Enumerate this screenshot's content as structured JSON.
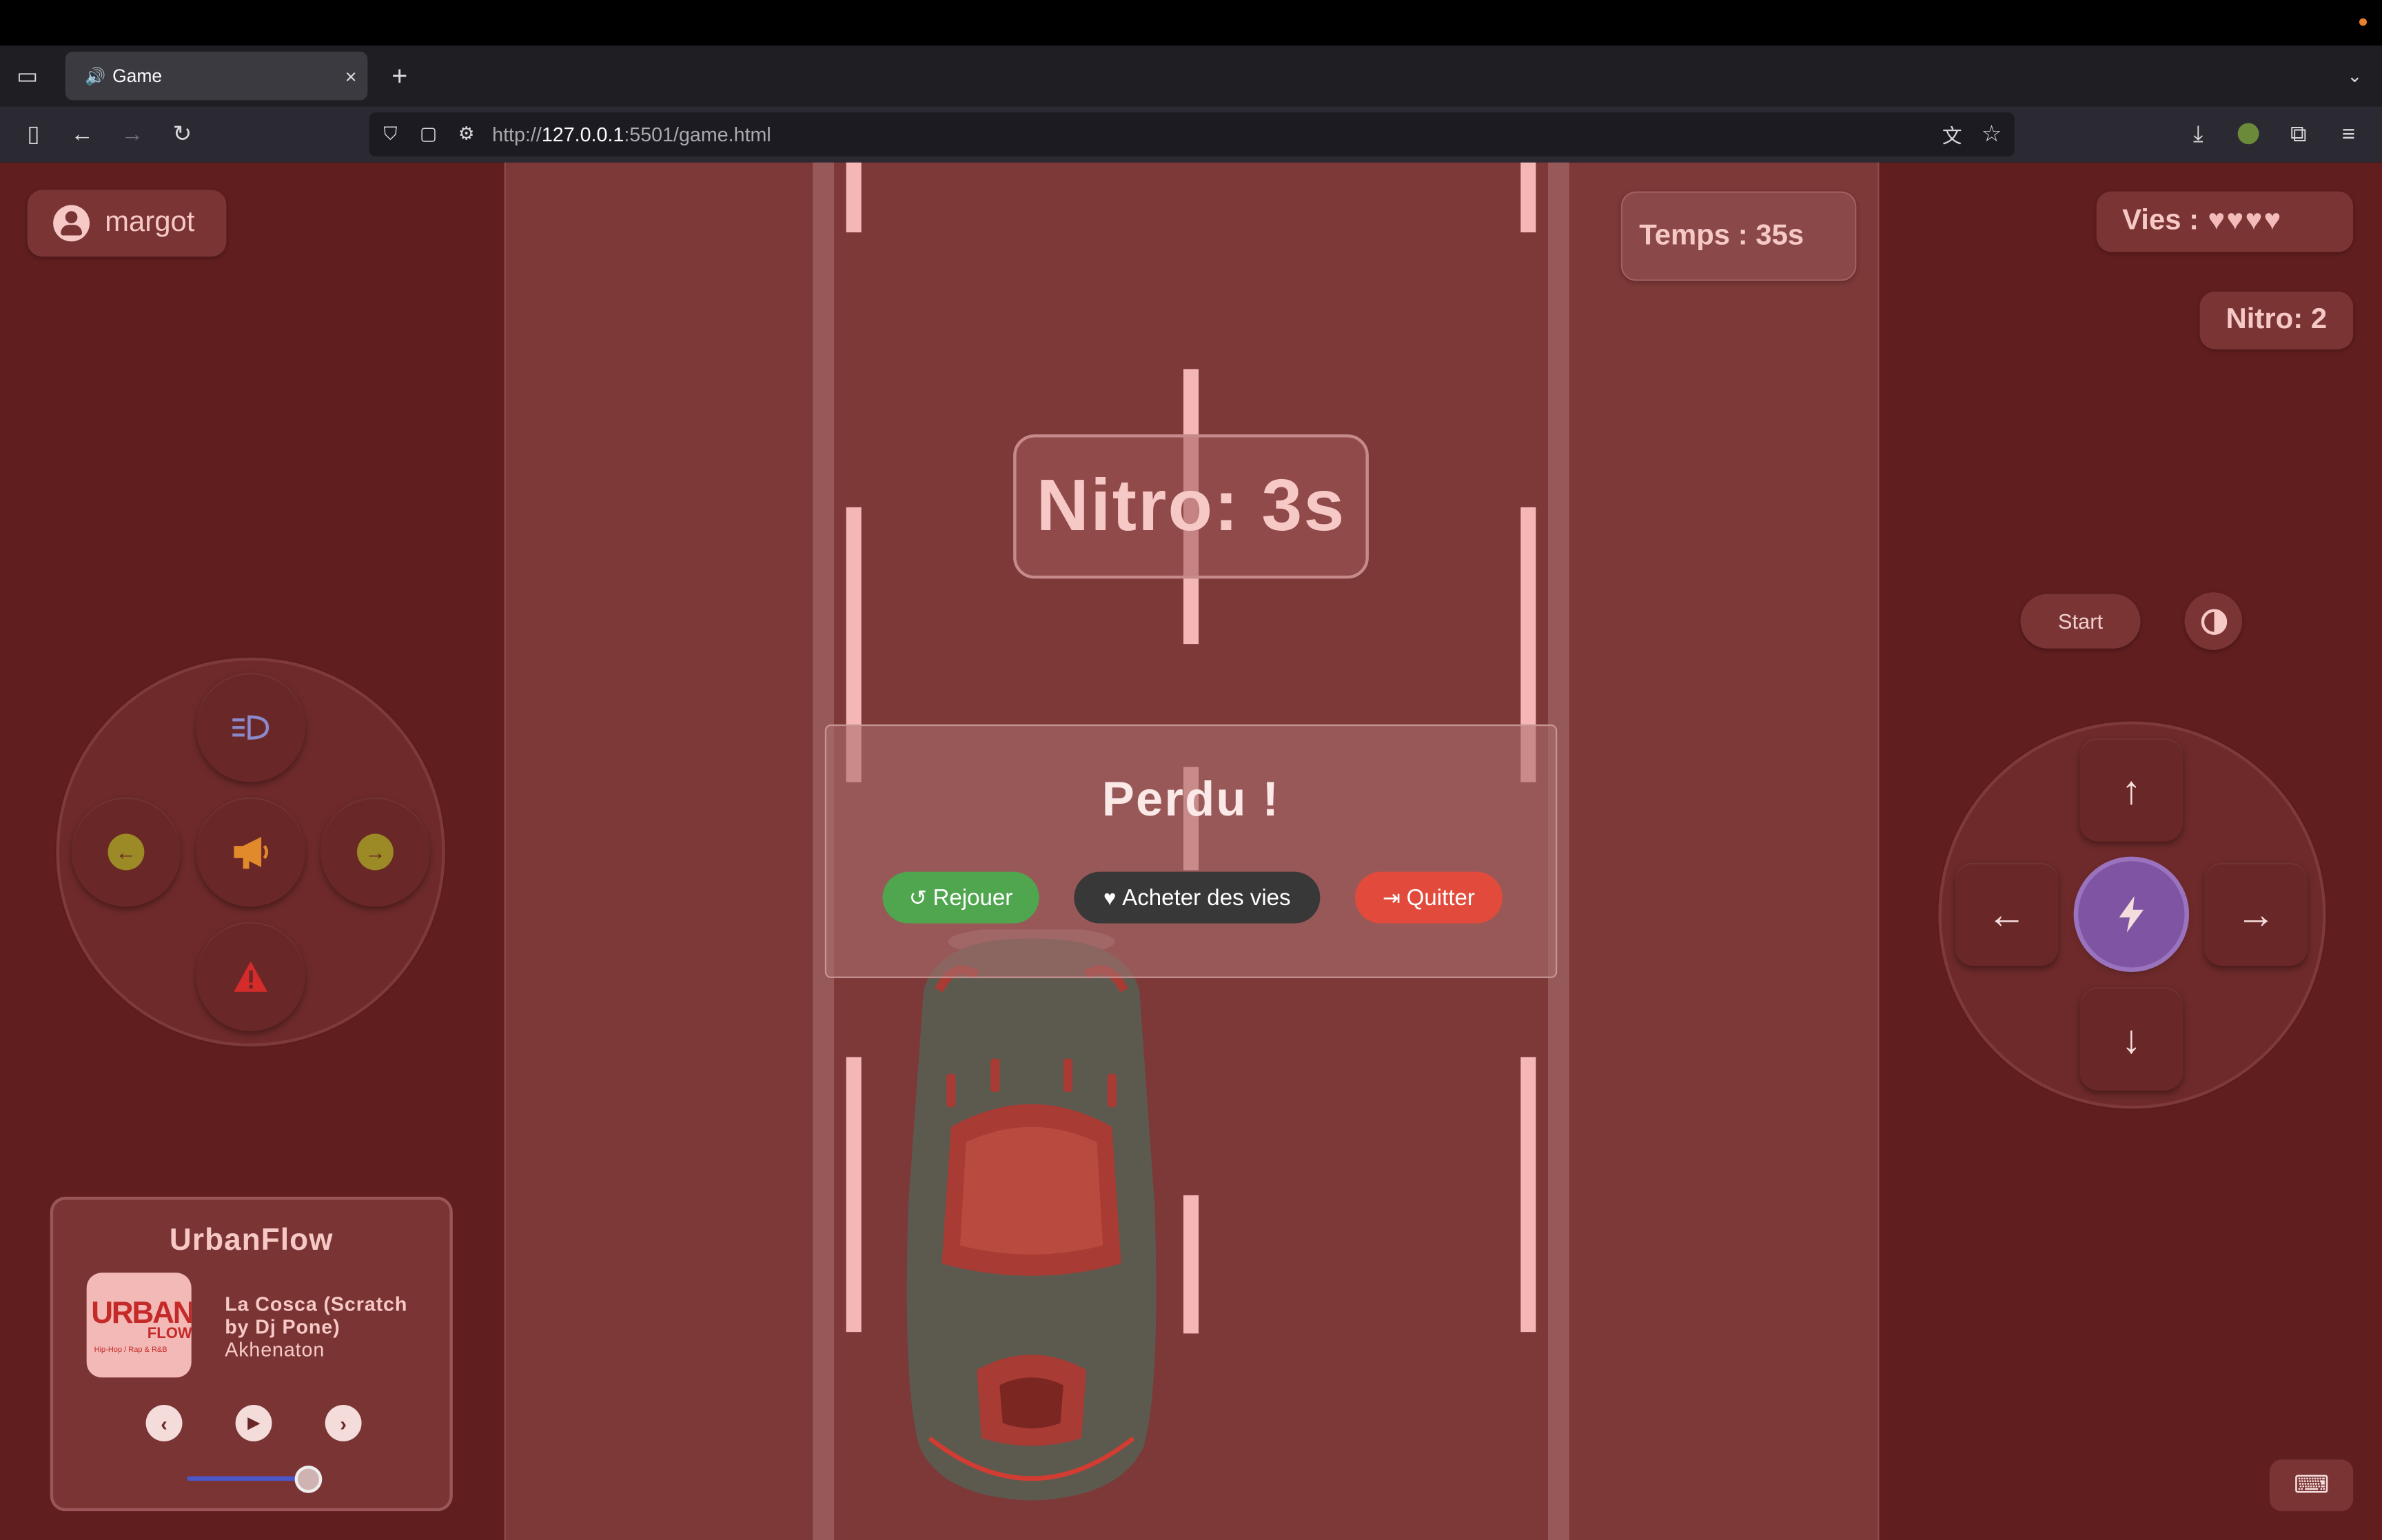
{
  "browser": {
    "tab_title": "Game",
    "tab_close": "×",
    "new_tab": "+",
    "url_prefix": "http://",
    "url_host": "127.0.0.1",
    "url_rest": ":5501/game.html"
  },
  "user": {
    "name": "margot"
  },
  "hud": {
    "temps": "Temps : 35s",
    "vies_label": "Vies :",
    "vies_hearts": "♥♥♥♥",
    "lives": 4,
    "nitro_count": "Nitro: 2",
    "nitro_timer": "Nitro: 3s"
  },
  "controls": {
    "start_label": "Start",
    "up_arrow": "↑",
    "down_arrow": "↓",
    "left_arrow": "←",
    "right_arrow": "→"
  },
  "dialog": {
    "title": "Perdu !",
    "replay_label": "Rejouer",
    "buy_label": "Acheter des vies",
    "quit_label": "Quitter"
  },
  "music": {
    "station": "UrbanFlow",
    "track": "La Cosca (Scratch by Dj Pone)",
    "artist": "Akhenaton",
    "logo_main": "URBAN",
    "logo_sub": "FLOW",
    "logo_tag": "Hip-Hop / Rap & R&B",
    "volume": 0.85
  },
  "colors": {
    "page_bg": "#611e1f",
    "road": "#7d3838",
    "lane_marking": "#f4b7b5",
    "panel": "#7a3434",
    "replay": "#4fa64f",
    "buy": "#383838",
    "quit": "#e24b3b",
    "boost": "#7e54a3"
  },
  "icons": {
    "headlight": "headlight-icon",
    "horn": "megaphone-icon",
    "left_signal": "left-signal-icon",
    "right_signal": "right-signal-icon",
    "hazard": "hazard-icon",
    "boost": "lightning-icon",
    "contrast": "contrast-icon",
    "keyboard": "keyboard-icon"
  }
}
